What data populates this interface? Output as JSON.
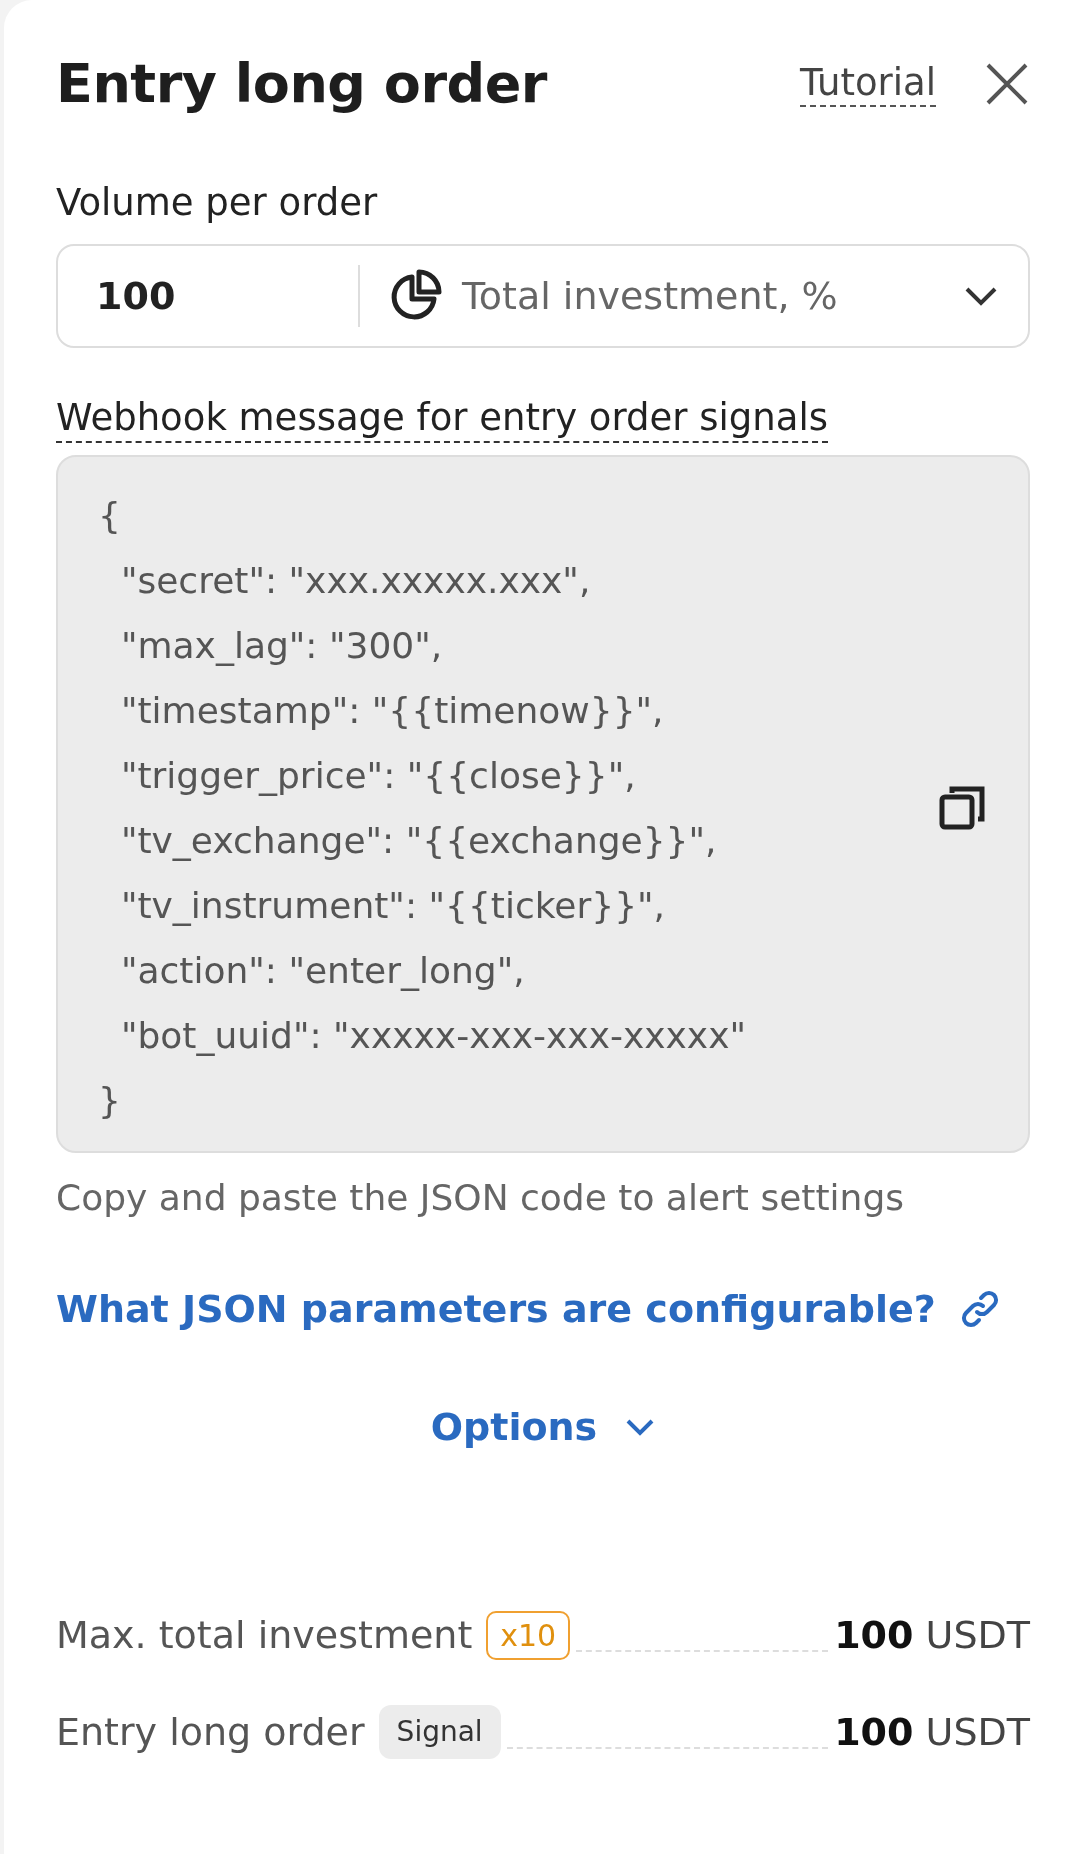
{
  "header": {
    "title": "Entry long order",
    "tutorial_link": "Tutorial"
  },
  "volume": {
    "label": "Volume per order",
    "value": "100",
    "unit_select": "Total investment, %"
  },
  "webhook": {
    "label": "Webhook message for entry order signals",
    "code_lines": [
      "{",
      "  \"secret\": \"xxx.xxxxx.xxx\",",
      "  \"max_lag\": \"300\",",
      "  \"timestamp\": \"{{timenow}}\",",
      "  \"trigger_price\": \"{{close}}\",",
      "  \"tv_exchange\": \"{{exchange}}\",",
      "  \"tv_instrument\": \"{{ticker}}\",",
      "  \"action\": \"enter_long\",",
      "  \"bot_uuid\": \"xxxxx-xxx-xxx-xxxxx\"",
      "}"
    ],
    "hint": "Copy and paste the JSON code to alert settings"
  },
  "help_link": "What JSON parameters are configurable?",
  "options": {
    "label": "Options",
    "expanded": false
  },
  "summary": [
    {
      "label": "Max. total investment",
      "badge": "x10",
      "kind": "outline",
      "value": "**100** USDT"
    },
    {
      "label": "Entry long order",
      "badge": "Signal",
      "kind": "filled",
      "value": "**100** USDT"
    }
  ]
}
